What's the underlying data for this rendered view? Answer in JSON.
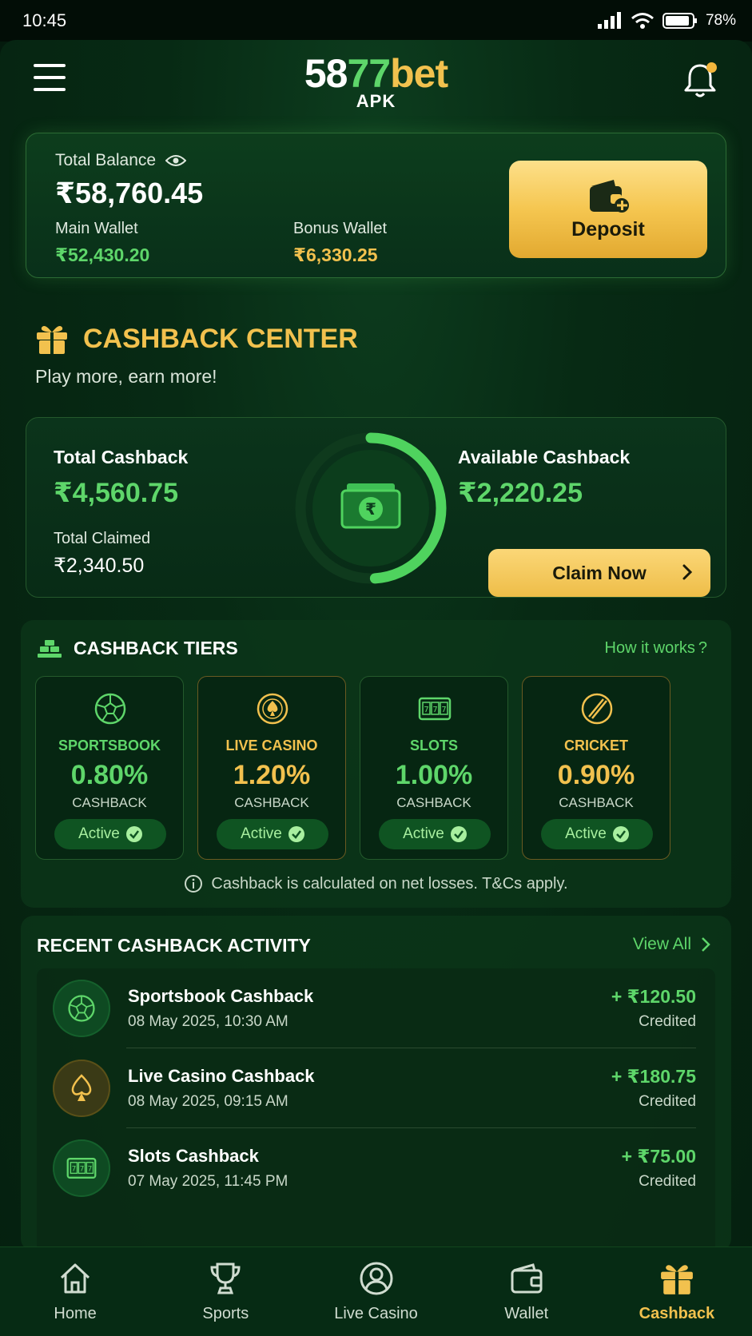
{
  "status_bar": {
    "time": "10:45",
    "battery": "78%"
  },
  "header": {
    "logo_a": "58",
    "logo_b": "77",
    "logo_c": "bet",
    "logo_sub": "APK"
  },
  "balance": {
    "total_label": "Total Balance",
    "total_value": "₹58,760.45",
    "main_label": "Main Wallet",
    "main_value": "₹52,430.20",
    "bonus_label": "Bonus Wallet",
    "bonus_value": "₹6,330.25",
    "deposit_label": "Deposit"
  },
  "cashback_center": {
    "title": "CASHBACK CENTER",
    "subtitle": "Play more, earn more!",
    "total_label": "Total Cashback",
    "total_value": "₹4,560.75",
    "claimed_label": "Total Claimed",
    "claimed_value": "₹2,340.50",
    "available_label": "Available Cashback",
    "available_value": "₹2,220.25",
    "claim_label": "Claim Now",
    "ring_progress": 0.49
  },
  "tiers": {
    "title": "CASHBACK TIERS",
    "how_link": "How it works",
    "note": "Cashback is calculated on net losses. T&Cs apply.",
    "items": [
      {
        "name": "SPORTSBOOK",
        "pct": "0.80%",
        "sub": "CASHBACK",
        "status": "Active",
        "accent": "#5ed66a",
        "icon": "soccer-ball-icon"
      },
      {
        "name": "LIVE CASINO",
        "pct": "1.20%",
        "sub": "CASHBACK",
        "status": "Active",
        "accent": "#f2c14e",
        "icon": "spade-chip-icon"
      },
      {
        "name": "SLOTS",
        "pct": "1.00%",
        "sub": "CASHBACK",
        "status": "Active",
        "accent": "#5ed66a",
        "icon": "slot-machine-icon"
      },
      {
        "name": "CRICKET",
        "pct": "0.90%",
        "sub": "CASHBACK",
        "status": "Active",
        "accent": "#f2c14e",
        "icon": "cricket-bat-icon"
      }
    ]
  },
  "activity": {
    "title": "RECENT CASHBACK ACTIVITY",
    "view_all": "View All",
    "items": [
      {
        "name": "Sportsbook Cashback",
        "date": "08 May 2025, 10:30 AM",
        "amount": "+ ₹120.50",
        "status": "Credited",
        "icon": "soccer-ball-icon"
      },
      {
        "name": "Live Casino Cashback",
        "date": "08 May 2025, 09:15 AM",
        "amount": "+ ₹180.75",
        "status": "Credited",
        "icon": "spade-icon"
      },
      {
        "name": "Slots Cashback",
        "date": "07 May 2025, 11:45 PM",
        "amount": "+ ₹75.00",
        "status": "Credited",
        "icon": "slot-machine-icon"
      }
    ]
  },
  "nav": {
    "items": [
      {
        "label": "Home",
        "icon": "home-icon"
      },
      {
        "label": "Sports",
        "icon": "trophy-icon"
      },
      {
        "label": "Live Casino",
        "icon": "user-circle-icon"
      },
      {
        "label": "Wallet",
        "icon": "wallet-icon"
      },
      {
        "label": "Cashback",
        "icon": "gift-icon",
        "active": true
      }
    ]
  },
  "colors": {
    "accent_green": "#5ed66a",
    "accent_gold": "#f2c14e",
    "background": "#05200f"
  }
}
